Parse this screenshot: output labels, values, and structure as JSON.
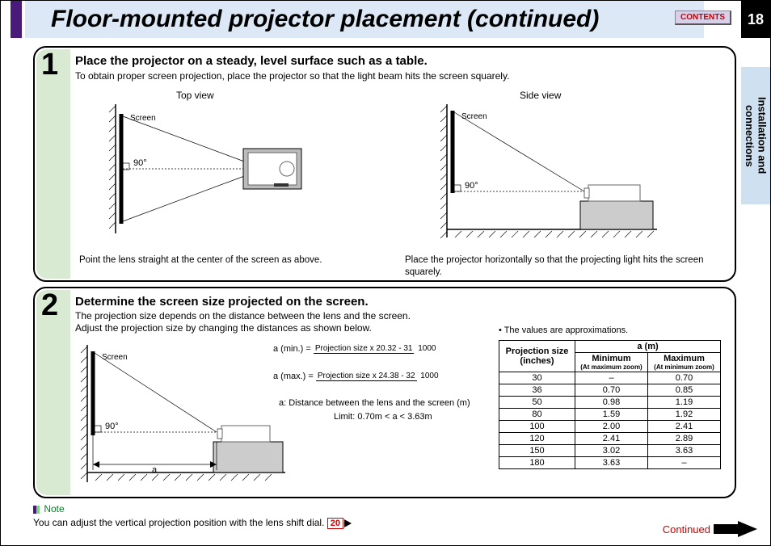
{
  "header": {
    "title": "Floor-mounted projector placement (continued)",
    "contents_btn": "CONTENTS",
    "page_number": "18"
  },
  "side_tab": "Installation and\nconnections",
  "step1": {
    "number": "1",
    "title": "Place the projector on a steady, level surface such as a table.",
    "desc": "To obtain proper screen projection, place the projector so that the light beam hits the screen squarely.",
    "top_view_label": "Top view",
    "side_view_label": "Side view",
    "screen_label": "Screen",
    "angle_label": "90°",
    "top_caption": "Point the lens straight at the center of the screen as above.",
    "side_caption": "Place the projector horizontally so that the projecting light hits the screen squarely."
  },
  "step2": {
    "number": "2",
    "title": "Determine the screen size projected on the screen.",
    "desc1": "The projection size depends on the distance between the lens and the screen.",
    "desc2": "Adjust the projection size by changing the distances as shown below.",
    "screen_label": "Screen",
    "angle_label": "90°",
    "a_label": "a",
    "formula_min_lhs": "a (min.) =",
    "formula_min_num": "Projection size x 20.32 - 31",
    "formula_min_den": "1000",
    "formula_max_lhs": "a (max.) =",
    "formula_max_num": "Projection size x 24.38 - 32",
    "formula_max_den": "1000",
    "a_desc": "a: Distance between the lens and the screen (m)",
    "limit": "Limit: 0.70m < a < 3.63m",
    "table_note": "• The values are approximations.",
    "table_header_proj": "Projection size (inches)",
    "table_header_am": "a (m)",
    "table_header_min": "Minimum",
    "table_header_max": "Maximum",
    "table_sub_min": "(At maximum zoom)",
    "table_sub_max": "(At minimum zoom)",
    "rows": [
      {
        "size": "30",
        "min": "–",
        "max": "0.70"
      },
      {
        "size": "36",
        "min": "0.70",
        "max": "0.85"
      },
      {
        "size": "50",
        "min": "0.98",
        "max": "1.19"
      },
      {
        "size": "80",
        "min": "1.59",
        "max": "1.92"
      },
      {
        "size": "100",
        "min": "2.00",
        "max": "2.41"
      },
      {
        "size": "120",
        "min": "2.41",
        "max": "2.89"
      },
      {
        "size": "150",
        "min": "3.02",
        "max": "3.63"
      },
      {
        "size": "180",
        "min": "3.63",
        "max": "–"
      }
    ]
  },
  "footer": {
    "note_label": "Note",
    "note_text": "You can adjust the vertical projection position with the lens shift dial.",
    "page_ref": "20",
    "continued": "Continued"
  }
}
